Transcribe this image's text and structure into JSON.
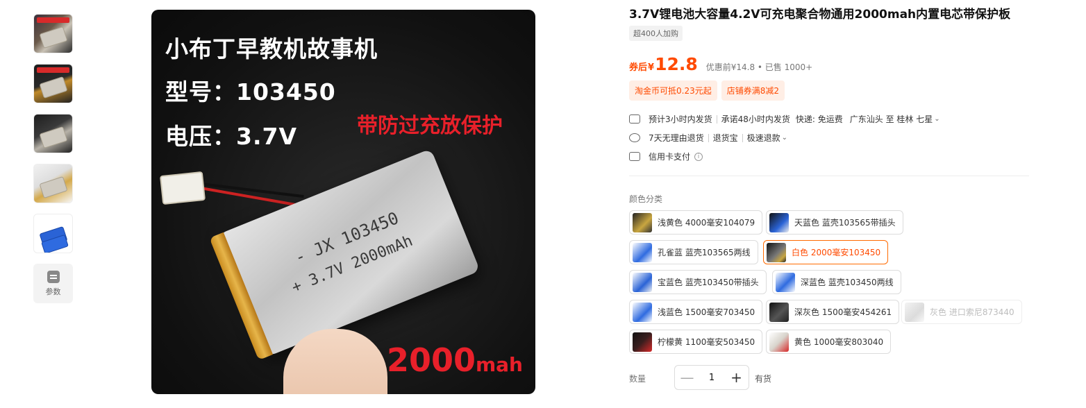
{
  "gallery": {
    "params_label": "参数"
  },
  "hero": {
    "line1": "小布丁早教机故事机",
    "line2": "型号：103450",
    "line3": "电压：3.7V",
    "warning": "带防过充放保护",
    "capacity_number": "2000",
    "capacity_unit": "mah",
    "cell_line1": "- JX 103450",
    "cell_line2": "+ 3.7V 2000mAh"
  },
  "product": {
    "title": "3.7V锂电池大容量4.2V可充电聚合物通用2000mah内置电芯带保护板",
    "buying_count": "超400人加购",
    "price_label": "券后",
    "price_currency": "¥",
    "price": "12.8",
    "original_info": "优惠前¥14.8 • 已售 1000+",
    "coupons": [
      "淘金币可抵0.23元起",
      "店铺券满8减2"
    ]
  },
  "services": {
    "delivery": "预计3小时内发货",
    "promise": "承诺48小时内发货",
    "shipping": "快递: 免运费",
    "route": "广东汕头 至 桂林 七星",
    "return7": "7天无理由退货",
    "return_insurance": "退货宝",
    "fast_refund": "极速退款",
    "credit": "信用卡支付"
  },
  "sku": {
    "label": "颜色分类",
    "options": [
      {
        "label": "浅黄色 4000毫安104079",
        "color": "#c9a640"
      },
      {
        "label": "天蓝色 蓝壳103565带插头",
        "color": "#2a63d6"
      },
      {
        "label": "孔雀蓝 蓝壳103565两线",
        "color": "#2f6be0"
      },
      {
        "label": "白色 2000毫安103450",
        "color": "#1d1d1d"
      },
      {
        "label": "宝蓝色 蓝壳103450带插头",
        "color": "#2a63d6"
      },
      {
        "label": "深蓝色 蓝壳103450两线",
        "color": "#2f6be0"
      },
      {
        "label": "浅蓝色 1500毫安703450",
        "color": "#2f6be0"
      },
      {
        "label": "深灰色 1500毫安454261",
        "color": "#222222"
      },
      {
        "label": "灰色 进口索尼873440",
        "color": "#9a9a9a"
      },
      {
        "label": "柠檬黄 1100毫安503450",
        "color": "#3a1e1e"
      },
      {
        "label": "黄色 1000毫安803040",
        "color": "#d8d4cc"
      }
    ],
    "selected": "白色 2000毫安103450",
    "disabled": "灰色 进口索尼873440"
  },
  "quantity": {
    "label": "数量",
    "value": "1",
    "minus": "—",
    "plus": "+",
    "stock": "有货"
  },
  "colors": {
    "accent": "#ff4a00",
    "coupon_bg": "#ffeee5",
    "hero_red": "#e8202a"
  }
}
